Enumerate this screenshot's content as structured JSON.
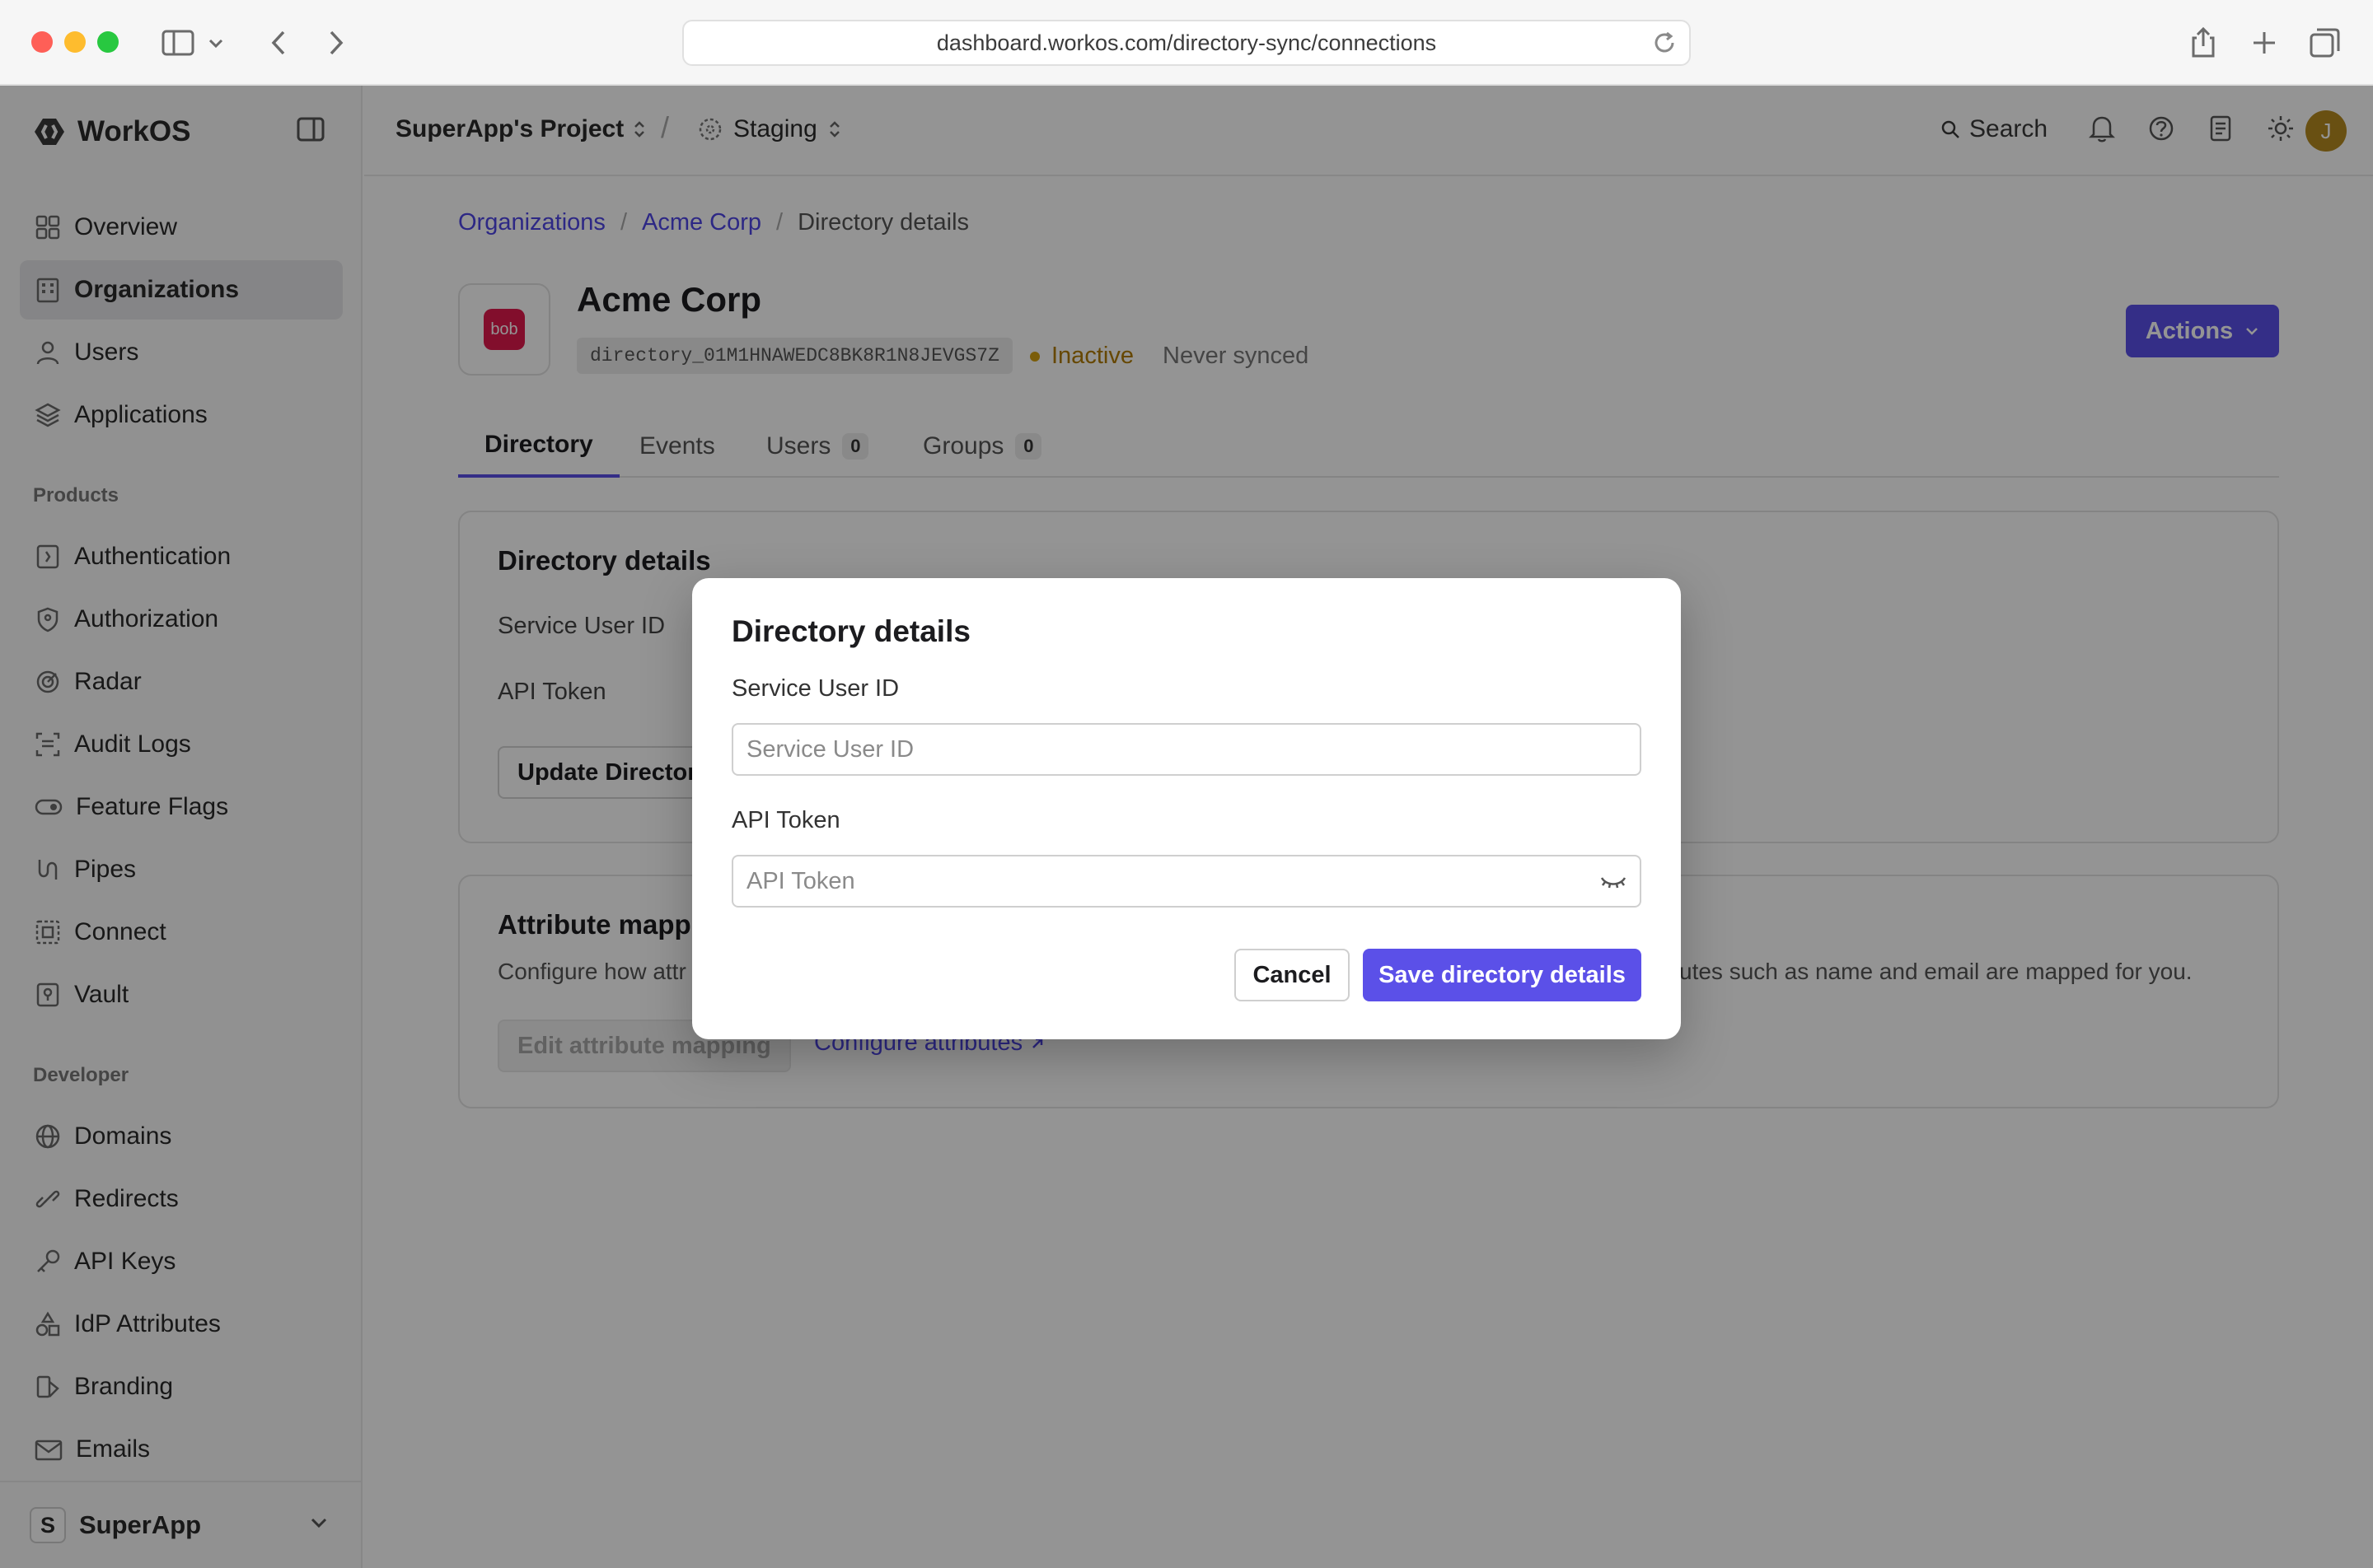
{
  "browser": {
    "url": "dashboard.workos.com/directory-sync/connections"
  },
  "sidebar": {
    "logo": "WorkOS",
    "main_items": [
      {
        "label": "Overview",
        "icon": "grid-icon"
      },
      {
        "label": "Organizations",
        "icon": "building-icon",
        "active": true
      },
      {
        "label": "Users",
        "icon": "user-icon"
      },
      {
        "label": "Applications",
        "icon": "layers-icon"
      }
    ],
    "products_label": "Products",
    "product_items": [
      {
        "label": "Authentication",
        "icon": "key-square-icon"
      },
      {
        "label": "Authorization",
        "icon": "shield-icon"
      },
      {
        "label": "Radar",
        "icon": "radar-icon"
      },
      {
        "label": "Audit Logs",
        "icon": "audit-icon"
      },
      {
        "label": "Feature Flags",
        "icon": "toggle-icon"
      },
      {
        "label": "Pipes",
        "icon": "pipes-icon"
      },
      {
        "label": "Connect",
        "icon": "connect-icon"
      },
      {
        "label": "Vault",
        "icon": "vault-icon"
      }
    ],
    "developer_label": "Developer",
    "developer_items": [
      {
        "label": "Domains",
        "icon": "globe-icon"
      },
      {
        "label": "Redirects",
        "icon": "link-icon"
      },
      {
        "label": "API Keys",
        "icon": "key-icon"
      },
      {
        "label": "IdP Attributes",
        "icon": "shapes-icon"
      },
      {
        "label": "Branding",
        "icon": "brush-icon"
      },
      {
        "label": "Emails",
        "icon": "mail-icon"
      }
    ],
    "workspace": {
      "initial": "S",
      "name": "SuperApp"
    }
  },
  "topbar": {
    "project": "SuperApp's Project",
    "separator": "/",
    "environment": "Staging",
    "search_label": "Search",
    "avatar_initial": "J"
  },
  "breadcrumb": {
    "items": [
      "Organizations",
      "Acme Corp"
    ],
    "current": "Directory details"
  },
  "org": {
    "name": "Acme Corp",
    "logo_text": "bob",
    "directory_id": "directory_01M1HNAWEDC8BK8R1N8JEVGS7Z",
    "status": "Inactive",
    "sync_status": "Never synced",
    "actions_label": "Actions"
  },
  "tabs": [
    {
      "label": "Directory",
      "active": true
    },
    {
      "label": "Events"
    },
    {
      "label": "Users",
      "count": "0"
    },
    {
      "label": "Groups",
      "count": "0"
    }
  ],
  "details_card": {
    "title": "Directory details",
    "service_user_id_label": "Service User ID",
    "api_token_label": "API Token",
    "update_button": "Update Director"
  },
  "attribute_card": {
    "title": "Attribute mapp",
    "description_start": "Configure how attr",
    "description_end": "utes such as name and email are mapped for you.",
    "edit_button": "Edit attribute mapping",
    "configure_link": "Configure attributes"
  },
  "modal": {
    "title": "Directory details",
    "service_user_id_label": "Service User ID",
    "service_user_id_placeholder": "Service User ID",
    "service_user_id_value": "",
    "api_token_label": "API Token",
    "api_token_placeholder": "API Token",
    "api_token_value": "",
    "cancel_label": "Cancel",
    "save_label": "Save directory details"
  },
  "colors": {
    "accent": "#5b50e8",
    "status_inactive": "#b07b00",
    "org_logo": "#e0194d"
  }
}
